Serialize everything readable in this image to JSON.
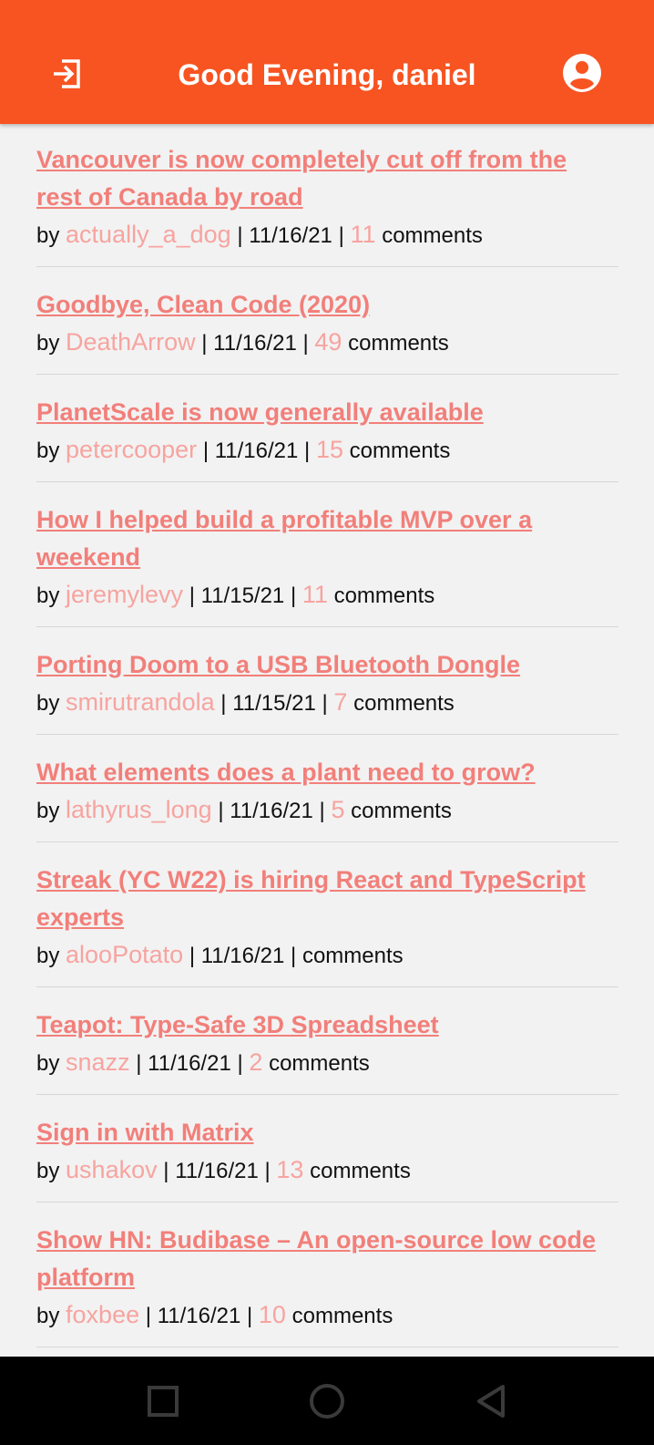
{
  "colors": {
    "header_bg": "#f75421",
    "link": "#f27f7a",
    "author": "#f7a4a0",
    "background": "#f2f2f2",
    "navbar": "#000000"
  },
  "header": {
    "title": "Good Evening, daniel",
    "login_icon": "login-icon",
    "account_icon": "account-circle-icon"
  },
  "labels": {
    "by": "by",
    "separator": "|",
    "comments": "comments"
  },
  "stories": [
    {
      "title": "Vancouver is now completely cut off from the rest of Canada by road",
      "author": "actually_a_dog",
      "date": "11/16/21",
      "comments": "11"
    },
    {
      "title": "Goodbye, Clean Code (2020)",
      "author": "DeathArrow",
      "date": "11/16/21",
      "comments": "49"
    },
    {
      "title": "PlanetScale is now generally available",
      "author": "petercooper",
      "date": "11/16/21",
      "comments": "15"
    },
    {
      "title": "How I helped build a profitable MVP over a weekend",
      "author": "jeremylevy",
      "date": "11/15/21",
      "comments": "11"
    },
    {
      "title": "Porting Doom to a USB Bluetooth Dongle",
      "author": "smirutrandola",
      "date": "11/15/21",
      "comments": "7"
    },
    {
      "title": "What elements does a plant need to grow?",
      "author": "lathyrus_long",
      "date": "11/16/21",
      "comments": "5"
    },
    {
      "title": "Streak (YC W22) is hiring React and TypeScript experts",
      "author": "alooPotato",
      "date": "11/16/21",
      "comments": ""
    },
    {
      "title": "Teapot: Type-Safe 3D Spreadsheet",
      "author": "snazz",
      "date": "11/16/21",
      "comments": "2"
    },
    {
      "title": "Sign in with Matrix",
      "author": "ushakov",
      "date": "11/16/21",
      "comments": "13"
    },
    {
      "title": "Show HN: Budibase – An open-source low code platform",
      "author": "foxbee",
      "date": "11/16/21",
      "comments": "10"
    }
  ],
  "navbar": {
    "recents_icon": "square-recents-icon",
    "home_icon": "circle-home-icon",
    "back_icon": "triangle-back-icon"
  }
}
